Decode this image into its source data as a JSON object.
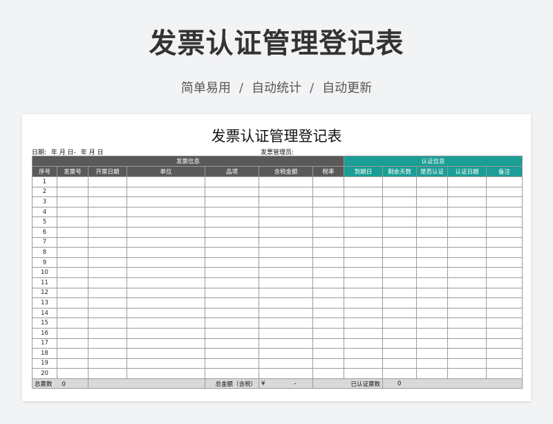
{
  "hero": {
    "title": "发票认证管理登记表",
    "subtitle_parts": [
      "简单易用",
      "自动统计",
      "自动更新"
    ],
    "separator": "/"
  },
  "sheet": {
    "title": "发票认证管理登记表",
    "date_label": "日期:",
    "date_from": "年  月  日-",
    "date_to": "年  月  日",
    "manager_label": "发票管理员:",
    "group_invoice": "发票信息",
    "group_cert": "认证信息",
    "columns": [
      "序号",
      "发票号",
      "开票日期",
      "单位",
      "品项",
      "含税金额",
      "税率",
      "到期日",
      "剩余天数",
      "是否认证",
      "认证日期",
      "备注"
    ],
    "rows": [
      "1",
      "2",
      "3",
      "4",
      "5",
      "6",
      "7",
      "8",
      "9",
      "10",
      "11",
      "12",
      "13",
      "14",
      "15",
      "16",
      "17",
      "18",
      "19",
      "20"
    ],
    "totals": {
      "count_label": "总票数",
      "count_value": "0",
      "amount_label": "总金额（含税）",
      "currency": "¥",
      "amount_value": "-",
      "cert_label": "已认证票数",
      "cert_value": "0"
    }
  },
  "colors": {
    "dark_header": "#595959",
    "teal_header": "#1a9e96",
    "total_row": "#d9d9d9"
  }
}
